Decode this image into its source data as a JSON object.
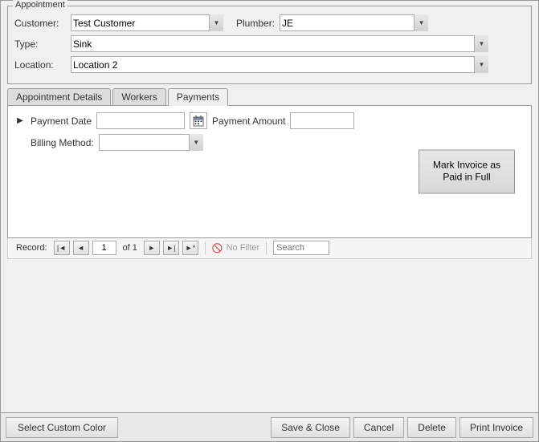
{
  "window": {
    "title": "Appointment"
  },
  "appointment": {
    "customer_label": "Customer:",
    "customer_value": "Test Customer",
    "plumber_label": "Plumber:",
    "plumber_value": "JE",
    "type_label": "Type:",
    "type_value": "Sink",
    "location_label": "Location:",
    "location_value": "Location 2"
  },
  "tabs": {
    "tab1_label": "Appointment Details",
    "tab2_label": "Workers",
    "tab3_label": "Payments"
  },
  "payments": {
    "payment_date_label": "Payment Date",
    "payment_amount_label": "Payment Amount",
    "billing_method_label": "Billing Method:",
    "payment_date_value": "",
    "payment_amount_value": "",
    "billing_method_value": "",
    "mark_paid_label": "Mark Invoice as Paid in Full"
  },
  "navigation": {
    "record_text": "Record:",
    "record_value": "1",
    "of_text": "of 1",
    "no_filter_text": "No Filter",
    "search_placeholder": "Search"
  },
  "bottom_bar": {
    "custom_color_label": "Select Custom Color",
    "save_close_label": "Save & Close",
    "cancel_label": "Cancel",
    "delete_label": "Delete",
    "print_invoice_label": "Print Invoice"
  }
}
